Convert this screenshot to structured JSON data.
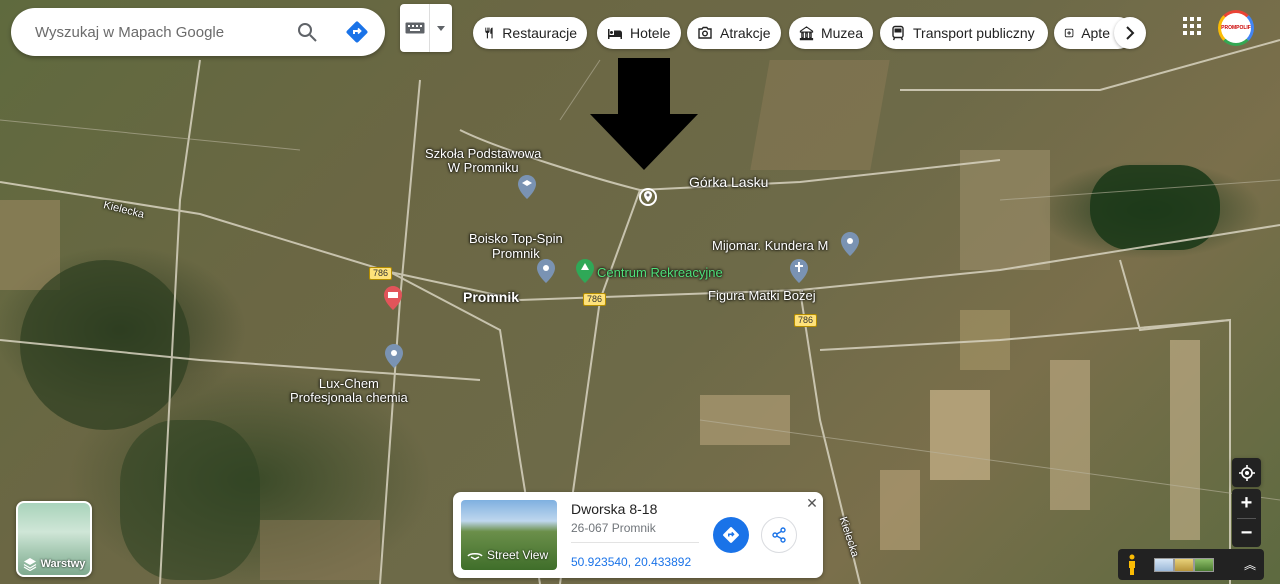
{
  "search": {
    "placeholder": "Wyszukaj w Mapach Google"
  },
  "chips": [
    {
      "label": "Restauracje",
      "icon": "restaurant-icon"
    },
    {
      "label": "Hotele",
      "icon": "hotel-icon"
    },
    {
      "label": "Atrakcje",
      "icon": "camera-icon"
    },
    {
      "label": "Muzea",
      "icon": "museum-icon"
    },
    {
      "label": "Transport publiczny",
      "icon": "transit-icon"
    },
    {
      "label": "Apte",
      "icon": "pharmacy-icon"
    }
  ],
  "account": {
    "avatar_text": "PROMPOLIF"
  },
  "map_labels": {
    "school": "Szkoła Podstawowa\nW Promniku",
    "gorka": "Górka Lasku",
    "boisko": "Boisko Top-Spin\nPromnik",
    "centrum": "Centrum Rekreacyjne",
    "mijomar": "Mijomar. Kundera M",
    "figura": "Figura Matki Bożej",
    "promnik": "Promnik",
    "luxchem": "Lux-Chem\nProfesjonala chemia",
    "kielecka_w": "Kielecka",
    "kielecka_s": "Kielecka"
  },
  "road_shields": {
    "r1": "786",
    "r2": "786",
    "r3": "786"
  },
  "layers": {
    "label": "Warstwy"
  },
  "card": {
    "title": "Dworska 8-18",
    "subtitle": "26-067 Promnik",
    "coords": "50.923540, 20.433892",
    "street_view": "Street View"
  },
  "colors": {
    "accent": "#1a73e8",
    "green_label": "#4fe07a"
  }
}
